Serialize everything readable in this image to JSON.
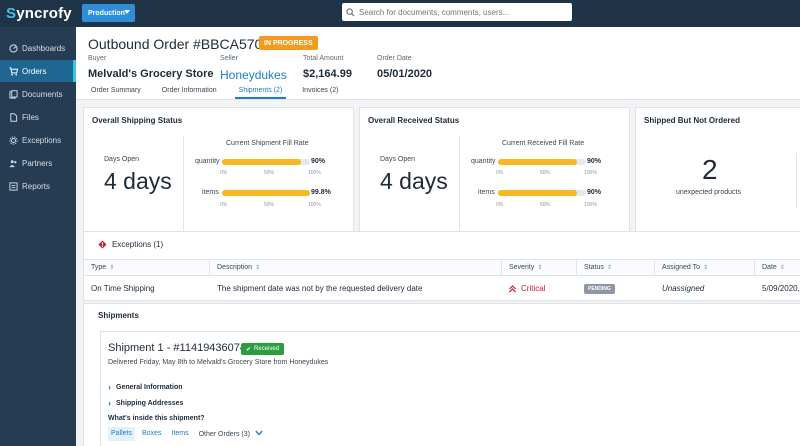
{
  "app": {
    "logo": "yncrofy",
    "logo_s": "S",
    "environment": "Production",
    "search_placeholder": "Search for documents, comments, users..."
  },
  "sidebar": {
    "items": [
      {
        "label": "Dashboards",
        "icon": "dashboard-icon"
      },
      {
        "label": "Orders",
        "icon": "cart-icon"
      },
      {
        "label": "Documents",
        "icon": "document-icon"
      },
      {
        "label": "Files",
        "icon": "file-icon"
      },
      {
        "label": "Exceptions",
        "icon": "gear-icon"
      },
      {
        "label": "Partners",
        "icon": "partners-icon"
      },
      {
        "label": "Reports",
        "icon": "report-icon"
      }
    ],
    "active_index": 1
  },
  "order": {
    "title": "Outbound Order #BBCA570C",
    "status": "IN PROGRESS",
    "buyer_label": "Buyer",
    "buyer": "Melvald's Grocery Store",
    "seller_label": "Seller",
    "seller": "Honeydukes",
    "amount_label": "Total Amount",
    "amount": "$2,164.99",
    "date_label": "Order Date",
    "date": "05/01/2020"
  },
  "tabs": [
    {
      "label": "Order Summary"
    },
    {
      "label": "Order Information"
    },
    {
      "label": "Shipments (2)"
    },
    {
      "label": "Invoices (2)"
    }
  ],
  "shipping_status": {
    "title": "Overall Shipping Status",
    "days_label": "Days Open",
    "days_value": "4 days",
    "fill_title": "Current Shipment Fill Rate",
    "bars": [
      {
        "label": "quantity",
        "pct_text": "90%",
        "fill": 0.9
      },
      {
        "label": "items",
        "pct_text": "99.8%",
        "fill": 0.998
      }
    ],
    "ticks": [
      "0%",
      "50%",
      "100%"
    ]
  },
  "received_status": {
    "title": "Overall Received Status",
    "days_label": "Days Open",
    "days_value": "4 days",
    "fill_title": "Current Received Fill Rate",
    "bars": [
      {
        "label": "quantity",
        "pct_text": "90%",
        "fill": 0.9
      },
      {
        "label": "items",
        "pct_text": "90%",
        "fill": 0.9
      }
    ],
    "ticks": [
      "0%",
      "50%",
      "100%"
    ]
  },
  "shipped_not_ordered": {
    "title": "Shipped But Not Ordered",
    "count": "2",
    "count_label": "unexpected products"
  },
  "exceptions": {
    "title": "Exceptions (1)",
    "columns": [
      "Type",
      "Description",
      "Severity",
      "Status",
      "Assigned To",
      "Date"
    ],
    "rows": [
      {
        "type": "On Time Shipping",
        "description": "The shipment date was not by the requested delivery date",
        "severity": "Critical",
        "status": "PENDING",
        "assigned_to": "Unassigned",
        "date": "5/09/2020,"
      }
    ]
  },
  "shipments": {
    "title": "Shipments",
    "card": {
      "title": "Shipment 1 - #114194360742",
      "status": "Received",
      "description": "Delivered Friday, May 8th to Melvald's Grocery Store from Honeydukes",
      "expanders": [
        "General Information",
        "Shipping Addresses"
      ],
      "inside_label": "What's inside this shipment?",
      "subtabs": [
        "Pallets",
        "Boxes",
        "Items",
        "Other Orders (3)"
      ]
    }
  },
  "colors": {
    "topbar": "#1f3447",
    "sidebar": "#263c52",
    "accent": "#1d7ec2",
    "progress": "#f4b924",
    "in_progress": "#f39b1e",
    "critical": "#c8202e",
    "received": "#2a9d3f"
  }
}
